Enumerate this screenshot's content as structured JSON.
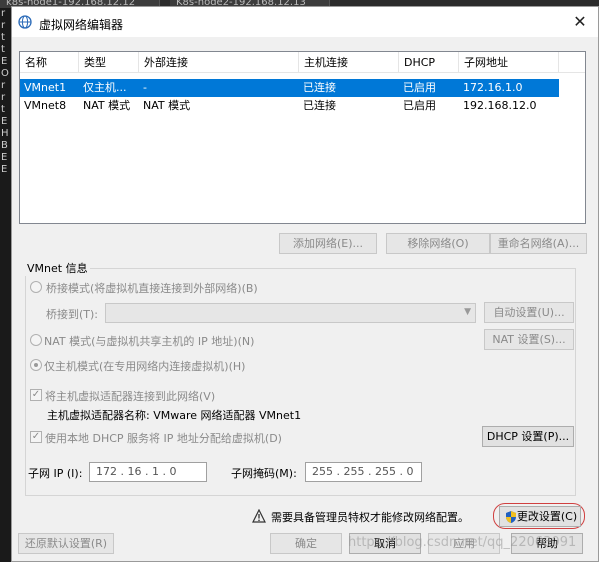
{
  "background": {
    "tabs": [
      "k8s-node1-192.168.12.12",
      "K8s-node2-192.168.12.13"
    ],
    "left_chars": [
      "r",
      "r",
      "t",
      "t",
      "E",
      "O",
      "r",
      "r",
      "t",
      "E",
      "H",
      "B",
      "E",
      "E"
    ]
  },
  "dialog": {
    "title": "虚拟网络编辑器",
    "close_glyph": "✕"
  },
  "table": {
    "columns": [
      "名称",
      "类型",
      "外部连接",
      "主机连接",
      "DHCP",
      "子网地址"
    ],
    "rows": [
      {
        "name": "VMnet1",
        "type": "仅主机...",
        "external": "-",
        "host": "已连接",
        "dhcp": "已启用",
        "subnet": "172.16.1.0",
        "selected": true
      },
      {
        "name": "VMnet8",
        "type": "NAT 模式",
        "external": "NAT 模式",
        "host": "已连接",
        "dhcp": "已启用",
        "subnet": "192.168.12.0",
        "selected": false
      }
    ]
  },
  "list_buttons": {
    "add": "添加网络(E)...",
    "remove": "移除网络(O)",
    "rename": "重命名网络(A)..."
  },
  "vmnet_info": {
    "group_label": "VMnet 信息",
    "bridge_mode": "桥接模式(将虚拟机直接连接到外部网络)(B)",
    "bridge_to_label": "桥接到(T):",
    "bridge_to_value": "",
    "auto_settings": "自动设置(U)...",
    "nat_mode": "NAT 模式(与虚拟机共享主机的 IP 地址)(N)",
    "nat_settings": "NAT 设置(S)...",
    "host_only": "仅主机模式(在专用网络内连接虚拟机)(H)",
    "connect_adapter": "将主机虚拟适配器连接到此网络(V)",
    "adapter_name": "主机虚拟适配器名称: VMware 网络适配器 VMnet1",
    "use_dhcp": "使用本地 DHCP 服务将 IP 地址分配给虚拟机(D)",
    "dhcp_settings": "DHCP 设置(P)...",
    "subnet_ip_label": "子网 IP (I):",
    "subnet_ip": "172 . 16 . 1 . 0",
    "subnet_mask_label": "子网掩码(M):",
    "subnet_mask": "255 . 255 . 255 . 0",
    "selected_mode": "host_only",
    "connect_adapter_checked": true,
    "use_dhcp_checked": true
  },
  "footer": {
    "admin_notice": "需要具备管理员特权才能修改网络配置。",
    "change_settings": "更改设置(C)",
    "restore_defaults": "还原默认设置(R)",
    "ok": "确定",
    "cancel": "取消",
    "apply": "应用",
    "help": "帮助",
    "watermark": "https://blog.csdn.net/qq_22063091"
  },
  "colors": {
    "selection": "#0078d7",
    "highlight_ring": "#d04040",
    "warning": "#f0c020",
    "shield_blue": "#2060c0",
    "shield_yellow": "#f0c020"
  }
}
